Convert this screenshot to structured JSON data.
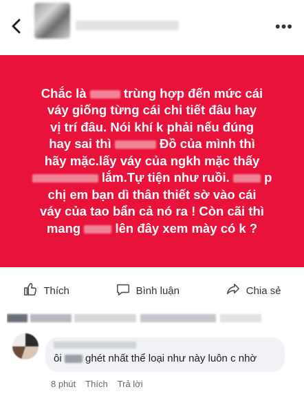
{
  "post_text": {
    "l1a": "Chắc là",
    "l1b": "trùng hợp đến mức cái",
    "l2": "váy giống từng cái chi tiết đâu hay",
    "l3": "vị trí đâu. Nói khí k phải nếu đúng",
    "l4a": "hay sai thì",
    "l4b": "Đồ của mình thì",
    "l5": "hãy mặc.lấy váy của ngkh mặc thấy",
    "l6a": "lắm.Tự tiện như ruồi.",
    "l6b": "p",
    "l7": "chị em bạn dì thân thiết sờ vào cái",
    "l8": "váy của tao bẩn cả nó ra ! Còn cãi thì",
    "l9a": "mang",
    "l9b": "lên đây xem mày có k ?"
  },
  "actions": {
    "like": "Thích",
    "comment": "Bình luận",
    "share": "Chia sẻ"
  },
  "comment": {
    "text_a": "ôi",
    "text_b": "ghét nhất thể loại như này luôn c nhờ",
    "time": "8 phút",
    "like": "Thích",
    "reply": "Trả lời"
  },
  "colors": {
    "post_background": "#e8123a",
    "post_text": "#ffffff"
  }
}
